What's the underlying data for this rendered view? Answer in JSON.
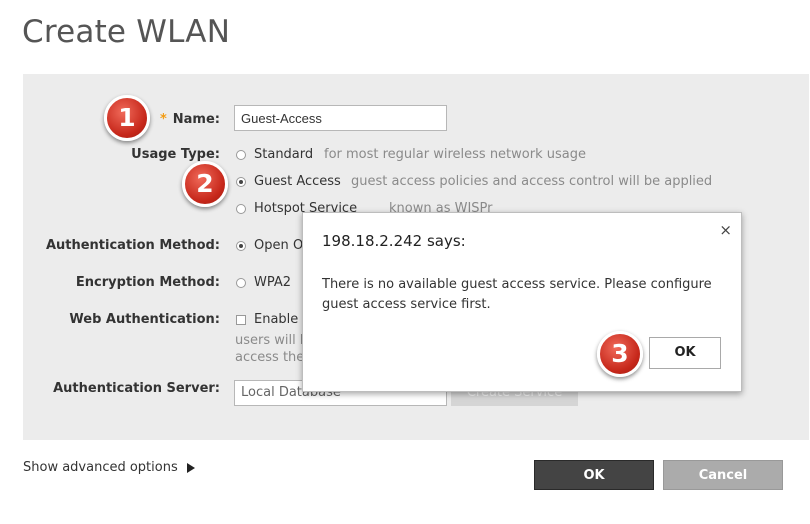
{
  "page": {
    "title": "Create WLAN"
  },
  "form": {
    "name_required": "*",
    "name_label": "Name:",
    "name_value": "Guest-Access",
    "usage_label": "Usage Type:",
    "usage_options": [
      {
        "label": "Standard",
        "hint": "for most regular wireless network usage",
        "selected": false
      },
      {
        "label": "Guest Access",
        "hint": "guest access policies and access control will be applied",
        "selected": true
      },
      {
        "label": "Hotspot Service",
        "hint": "known as WISPr",
        "selected": false
      }
    ],
    "auth_method_label": "Authentication Method:",
    "auth_method_option": "Open",
    "auth_method_more": "O",
    "encryption_label": "Encryption Method:",
    "encryption_option": "WPA2",
    "webauth_label": "Web Authentication:",
    "webauth_check_label": "Enable c",
    "webauth_note_line1": "users will b",
    "webauth_note_line2": "access the",
    "auth_server_label": "Authentication Server:",
    "auth_server_value": "Local Database",
    "create_service_label": "Create Service"
  },
  "footer": {
    "advanced_label": "Show advanced options",
    "ok_label": "OK",
    "cancel_label": "Cancel"
  },
  "dialog": {
    "title": "198.18.2.242 says:",
    "close_glyph": "×",
    "message": "There is no available guest access service.  Please configure guest access service first.",
    "ok_label": "OK"
  },
  "annotations": [
    "1",
    "2",
    "3"
  ]
}
